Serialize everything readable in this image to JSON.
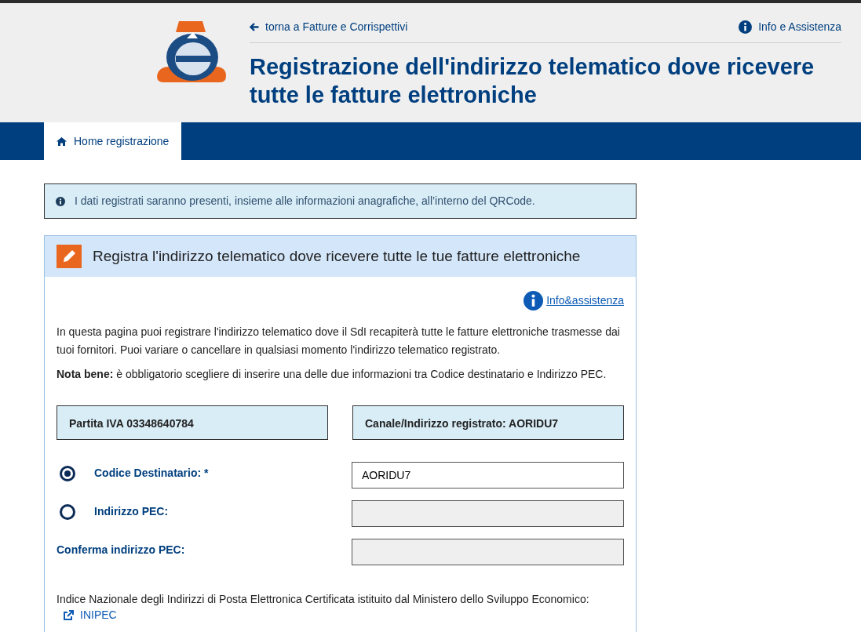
{
  "header": {
    "back_link": "torna a Fatture e Corrispettivi",
    "help_link": "Info e Assistenza",
    "title": "Registrazione dell'indirizzo telematico dove ricevere tutte le fatture elettroniche"
  },
  "nav": {
    "tabs": [
      {
        "label": "Home registrazione",
        "selected": true
      }
    ]
  },
  "notice": "I dati registrati saranno presenti, insieme alle informazioni anagrafiche, all’interno del QRCode.",
  "panel": {
    "title": "Registra l'indirizzo telematico dove ricevere tutte le tue fatture elettroniche",
    "help_link": "Info&assistenza",
    "paragraphs": [
      "In questa pagina puoi registrare l'indirizzo telematico dove il SdI recapiterà tutte le fatture elettroniche trasmesse dai tuoi fornitori. Puoi variare o cancellare in qualsiasi momento l'indirizzo telematico registrato.",
      "**Nota bene:** è obbligatorio scegliere di inserire una delle due informazioni tra Codice destinatario e Indirizzo PEC."
    ],
    "info_boxes": [
      "Partita IVA 03348640784",
      "Canale/Indirizzo registrato: AORIDU7"
    ],
    "fields": [
      {
        "kind": "radio",
        "label": "Codice Destinatario: *",
        "selected": true,
        "value": "AORIDU7",
        "disabled": false
      },
      {
        "kind": "radio",
        "label": "Indirizzo PEC:",
        "selected": false,
        "disabled": true
      },
      {
        "kind": "plain",
        "label": "Conferma indirizzo PEC:",
        "disabled": true
      }
    ],
    "footer_text": "Indice Nazionale degli Indirizzi di Posta Elettronica Certificata istituito dal Ministero dello Sviluppo Economico:",
    "footer_link": "INIPEC"
  }
}
